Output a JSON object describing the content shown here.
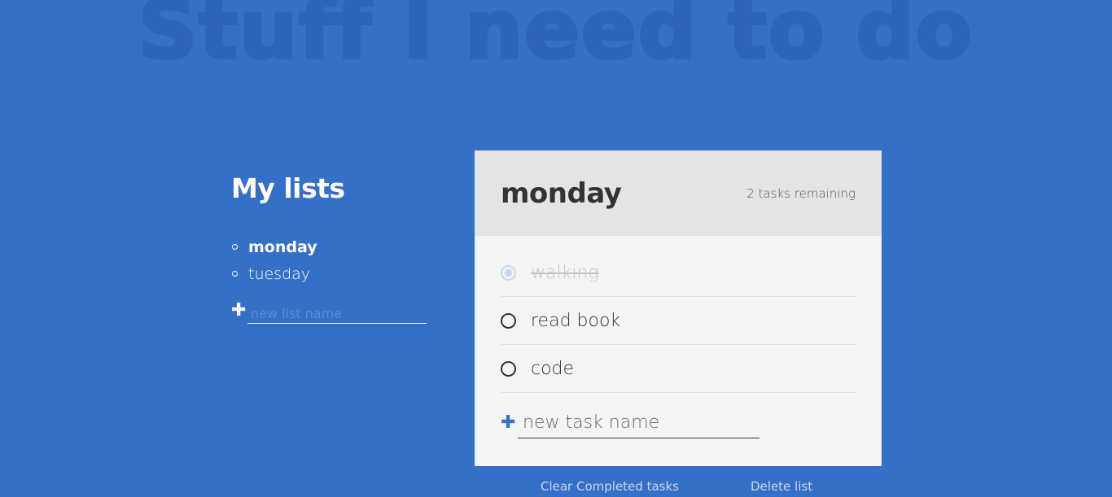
{
  "app": {
    "title": "Stuff I need to do"
  },
  "sidebar": {
    "heading": "My lists",
    "lists": [
      {
        "label": "monday",
        "active": true
      },
      {
        "label": "tuesday",
        "active": false
      }
    ],
    "new_list_placeholder": "new list name",
    "add_icon": "plus-icon"
  },
  "card": {
    "title": "monday",
    "remaining": "2 tasks remaining",
    "tasks": [
      {
        "label": "walking",
        "completed": true
      },
      {
        "label": "read book",
        "completed": false
      },
      {
        "label": "code",
        "completed": false
      }
    ],
    "new_task_placeholder": "new task name",
    "add_icon": "plus-icon"
  },
  "actions": {
    "clear_completed": "Clear Completed tasks",
    "delete_list": "Delete list"
  },
  "colors": {
    "background": "#3570c8",
    "title_watermark": "#2c64b9",
    "card": "#f4f4f4",
    "card_header": "#e4e4e4"
  }
}
